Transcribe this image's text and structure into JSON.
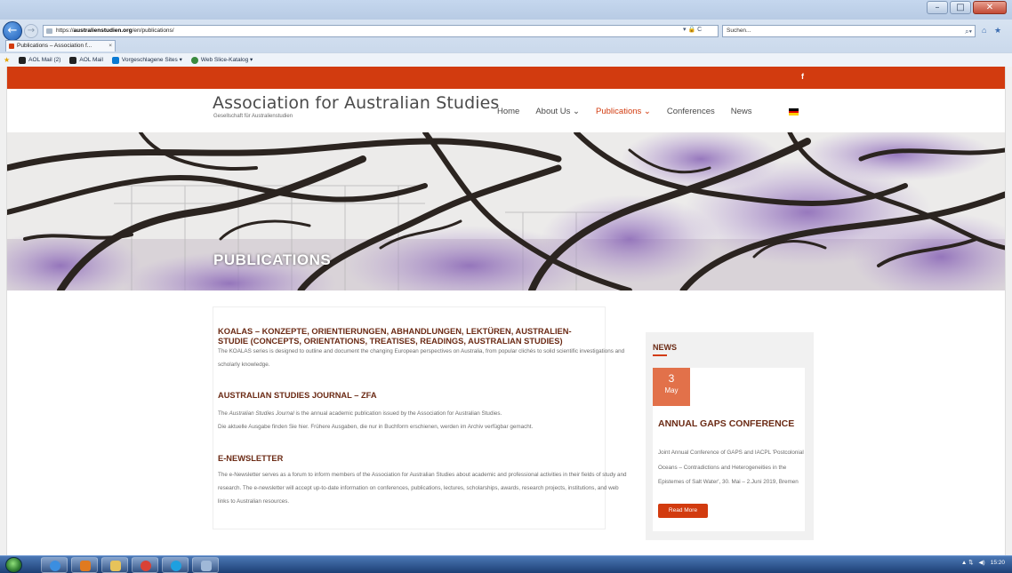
{
  "browser": {
    "address_url_prefix": "https://",
    "address_domain": "australienstudien.org",
    "address_path": "/en/publications/",
    "address_tools": "▾ 🔒 C",
    "search_placeholder": "Suchen...",
    "tab_title": "Publications – Association f...",
    "tab_close": "×",
    "favorites": [
      "AOL Mail (2)",
      "AOL Mail",
      "Vorgeschlagene Sites ▾",
      "Web Slice-Katalog ▾"
    ]
  },
  "site": {
    "topbar_facebook": "f",
    "brand_title": "Association for Australian Studies",
    "brand_subtitle": "Gesellschaft für Australienstudien",
    "nav": [
      {
        "label": "Home",
        "active": false
      },
      {
        "label": "About Us ⌄",
        "active": false
      },
      {
        "label": "Publications ⌄",
        "active": true
      },
      {
        "label": "Conferences",
        "active": false
      },
      {
        "label": "News",
        "active": false
      }
    ],
    "hero_title": "PUBLICATIONS",
    "sections": [
      {
        "title": "KOALAS – KONZEPTE, ORIENTIERUNGEN, ABHANDLUNGEN, LEKTÜREN, AUSTRALIEN-STUDIE (CONCEPTS, ORIENTATIONS, TREATISES, READINGS, AUSTRALIAN STUDIES)",
        "text": "The KOALAS series is designed to outline and document the changing European perspectives on Australia, from popular clichés to solid scientific investigations and scholarly knowledge."
      },
      {
        "title": "AUSTRALIAN STUDIES JOURNAL – ZFA",
        "text_em": "Australian Studies Journal",
        "text_pre": "The ",
        "text_post": " is the annual academic publication issued by the Association for Australian Studies.",
        "text_line2": "Die aktuelle Ausgabe finden Sie hier. Frühere Ausgaben, die nur in Buchform erschienen, werden im Archiv verfügbar gemacht."
      },
      {
        "title": "E-NEWSLETTER",
        "text": "The e-Newsletter serves as a forum to inform members of the Association for Australian Studies about academic and professional activities in their fields of study and research. The e-newsletter will accept up-to-date information on conferences, publications, lectures, scholarships, awards, research projects, institutions, and web links to Australian resources."
      }
    ],
    "sidebar": {
      "title": "NEWS",
      "event": {
        "day": "3",
        "month": "May",
        "title": "ANNUAL GAPS CONFERENCE",
        "text": "Joint Annual Conference of GAPS and IACPL 'Postcolonial Oceans – Contradictions and Heterogeneities in the Epistemes of Salt Water', 30. Mai – 2.Juni 2019, Bremen",
        "button": "Read More"
      }
    }
  },
  "taskbar": {
    "time": "15:20"
  },
  "colors": {
    "accent": "#d23b0f",
    "heading": "#6b2a14",
    "date_badge": "#e2714a"
  }
}
